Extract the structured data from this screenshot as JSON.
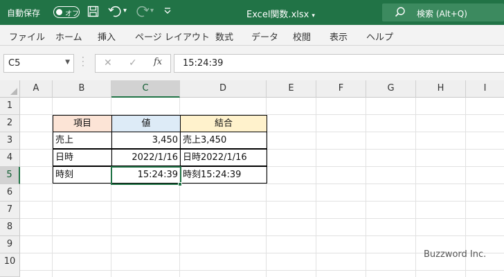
{
  "titlebar": {
    "autosave_label": "自動保存",
    "autosave_state": "オフ",
    "document_title": "Excel関数.xlsx",
    "search_placeholder": "検索 (Alt+Q)",
    "accent_color": "#217346"
  },
  "ribbon": {
    "tabs": [
      "ファイル",
      "ホーム",
      "挿入",
      "ページ レイアウト",
      "数式",
      "データ",
      "校閲",
      "表示",
      "ヘルプ"
    ]
  },
  "formula_bar": {
    "name_box": "C5",
    "formula": "15:24:39",
    "fx_label": "fx"
  },
  "grid": {
    "columns": [
      "A",
      "B",
      "C",
      "D",
      "E",
      "F",
      "G",
      "H",
      "I"
    ],
    "rows": [
      "1",
      "2",
      "3",
      "4",
      "5",
      "6",
      "7",
      "8",
      "9",
      "10"
    ],
    "selected_cell": "C5",
    "table": {
      "headers": [
        "項目",
        "値",
        "結合"
      ],
      "header_colors": [
        "#fce4d6",
        "#ddebf7",
        "#fff2cc"
      ],
      "rows": [
        [
          "売上",
          "3,450",
          "売上3,450"
        ],
        [
          "日時",
          "2022/1/16",
          "日時2022/1/16"
        ],
        [
          "時刻",
          "15:24:39",
          "時刻15:24:39"
        ]
      ]
    }
  },
  "watermark": "Buzzword Inc."
}
